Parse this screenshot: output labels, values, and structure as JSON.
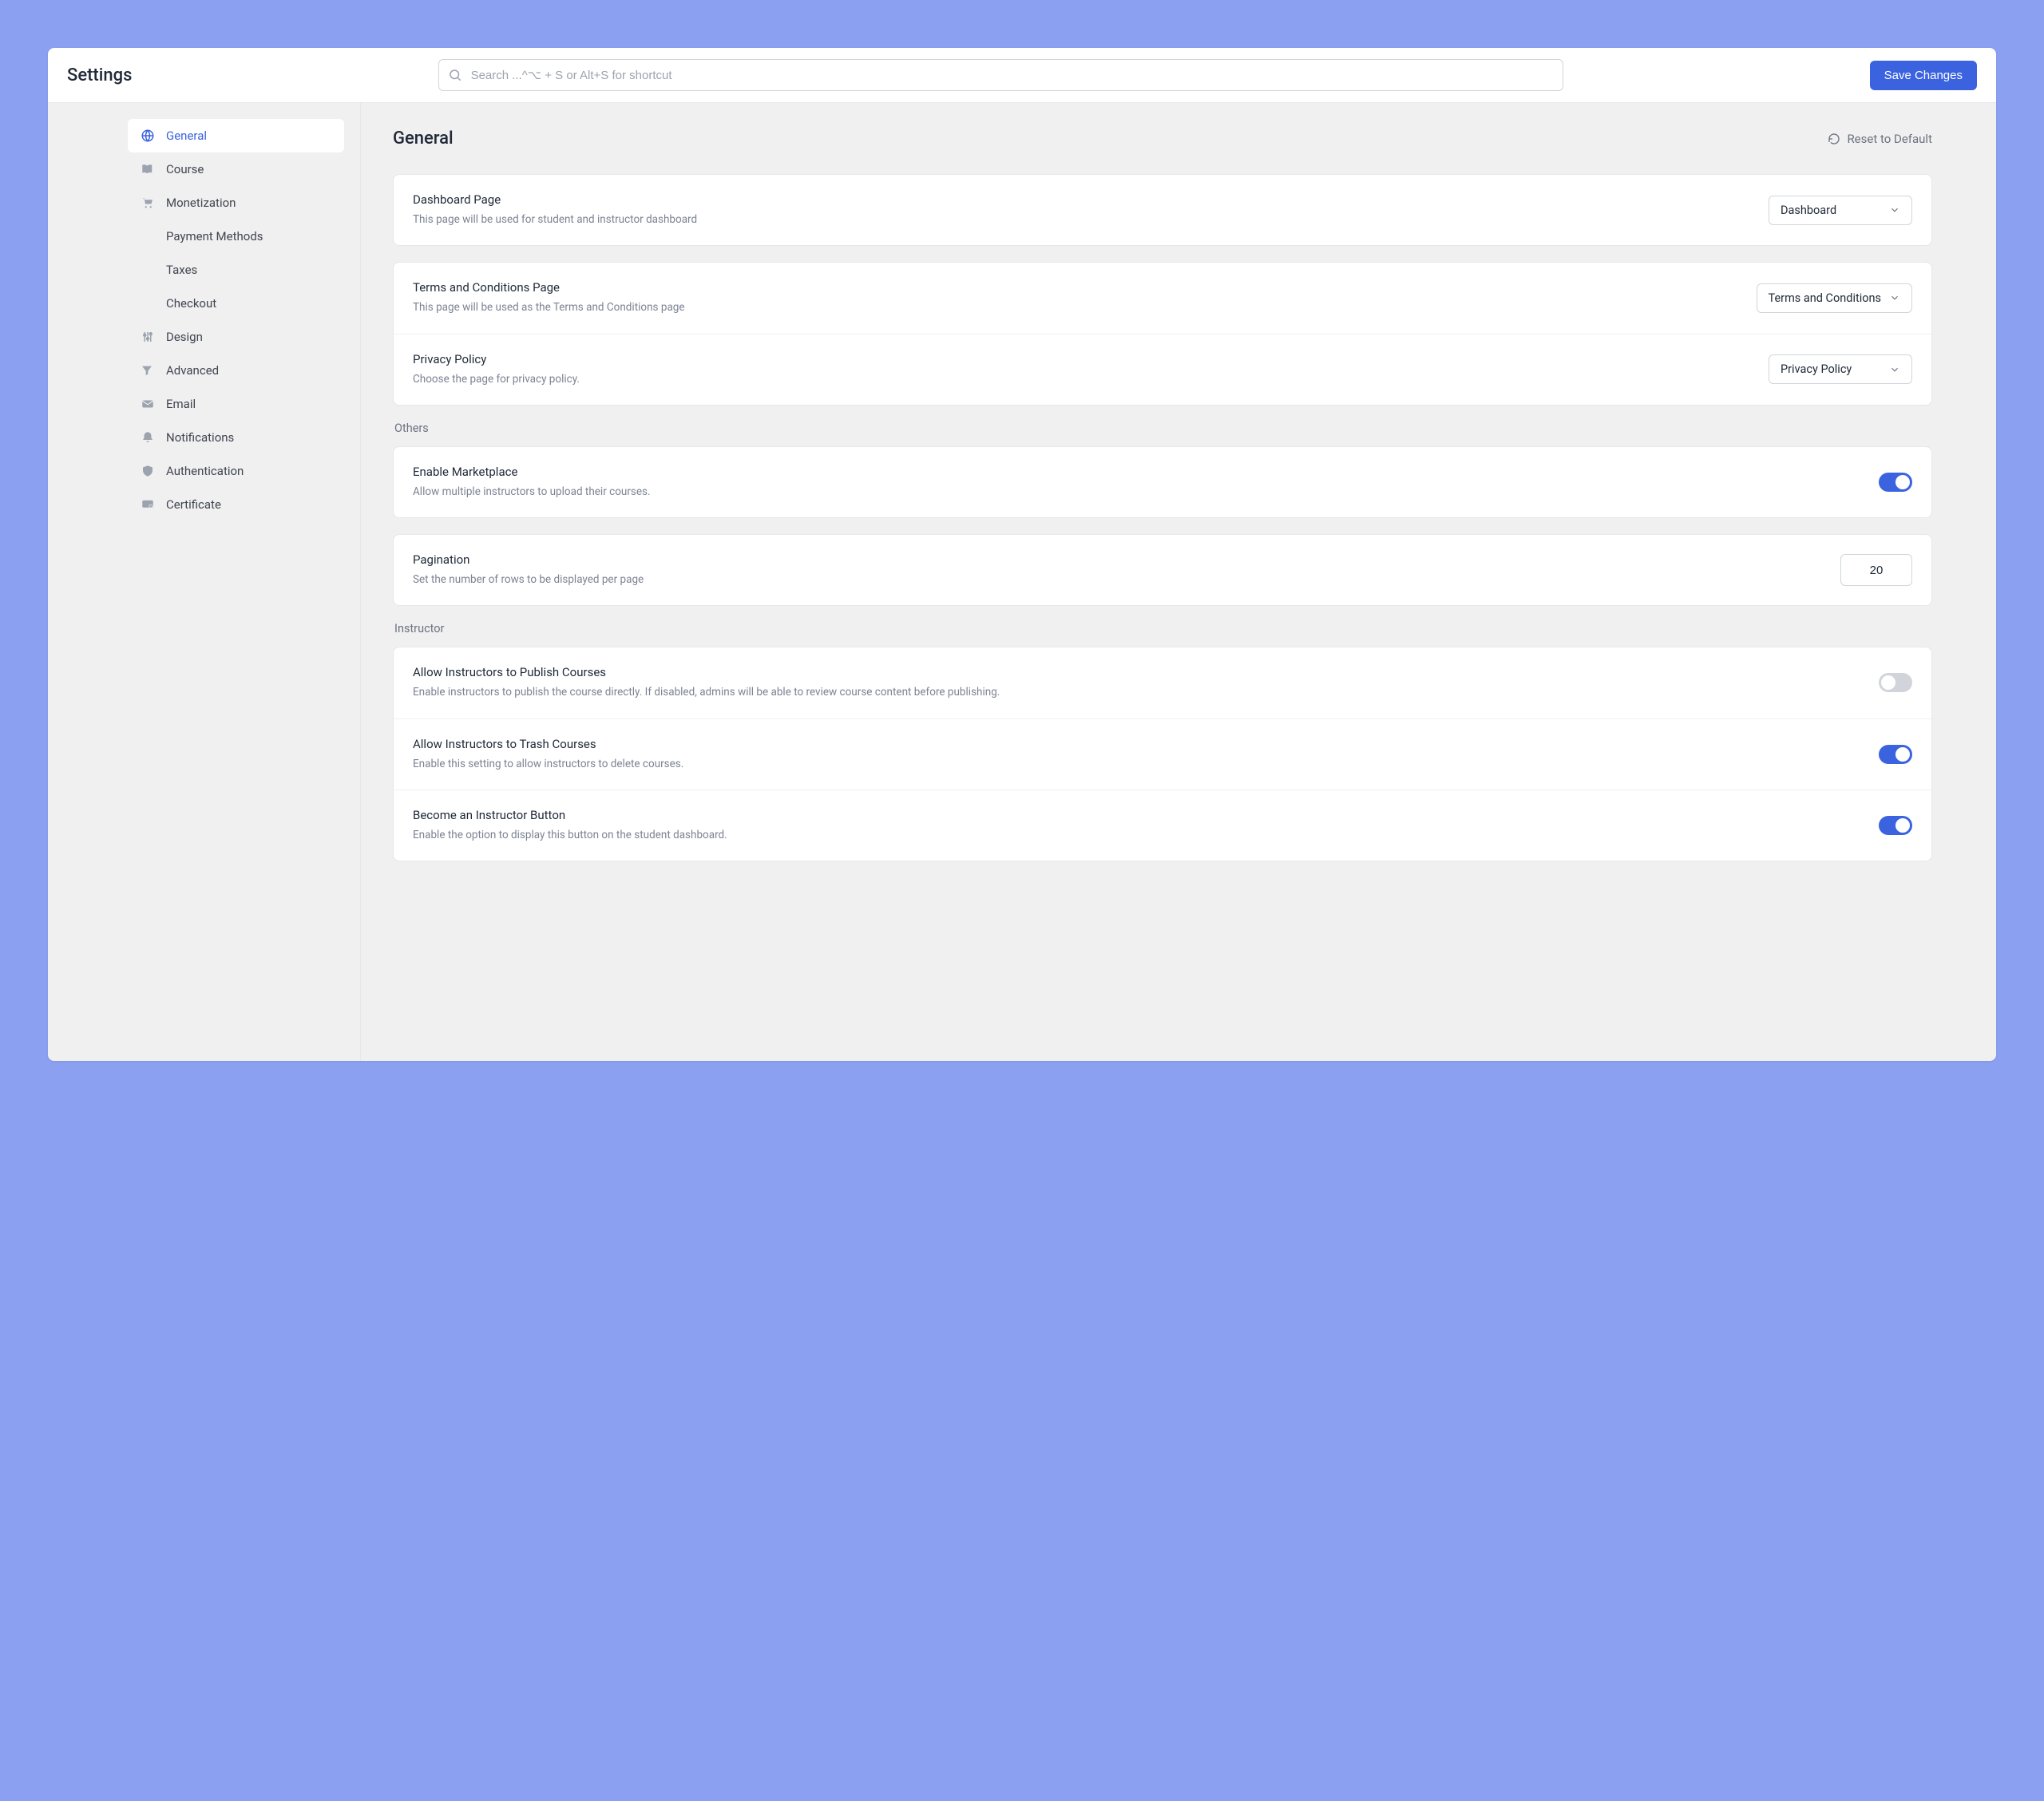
{
  "header": {
    "title": "Settings",
    "search_placeholder": "Search ...^⌥ + S or Alt+S for shortcut",
    "save_label": "Save Changes"
  },
  "sidebar": {
    "items": [
      {
        "id": "general",
        "label": "General",
        "active": true
      },
      {
        "id": "course",
        "label": "Course"
      },
      {
        "id": "monetization",
        "label": "Monetization",
        "children": [
          {
            "id": "payment-methods",
            "label": "Payment Methods"
          },
          {
            "id": "taxes",
            "label": "Taxes"
          },
          {
            "id": "checkout",
            "label": "Checkout"
          }
        ]
      },
      {
        "id": "design",
        "label": "Design"
      },
      {
        "id": "advanced",
        "label": "Advanced"
      },
      {
        "id": "email",
        "label": "Email"
      },
      {
        "id": "notifications",
        "label": "Notifications"
      },
      {
        "id": "authentication",
        "label": "Authentication"
      },
      {
        "id": "certificate",
        "label": "Certificate"
      }
    ]
  },
  "main": {
    "title": "General",
    "reset_label": "Reset to Default",
    "sections": {
      "page": [
        {
          "title": "Dashboard Page",
          "desc": "This page will be used for student and instructor dashboard",
          "select_value": "Dashboard"
        }
      ],
      "terms": [
        {
          "title": "Terms and Conditions Page",
          "desc": "This page will be used as the Terms and Conditions page",
          "select_value": "Terms and Conditions"
        },
        {
          "title": "Privacy Policy",
          "desc": "Choose the page for privacy policy.",
          "select_value": "Privacy Policy"
        }
      ],
      "others_label": "Others",
      "others": [
        {
          "title": "Enable Marketplace",
          "desc": "Allow multiple instructors to upload their courses.",
          "toggle": true
        },
        {
          "title": "Pagination",
          "desc": "Set the number of rows to be displayed per page",
          "value": "20"
        }
      ],
      "instructor_label": "Instructor",
      "instructor": [
        {
          "title": "Allow Instructors to Publish Courses",
          "desc": "Enable instructors to publish the course directly. If disabled, admins will be able to review course content before publishing.",
          "toggle": false
        },
        {
          "title": "Allow Instructors to Trash Courses",
          "desc": "Enable this setting to allow instructors to delete courses.",
          "toggle": true
        },
        {
          "title": "Become an Instructor Button",
          "desc": "Enable the option to display this button on the student dashboard.",
          "toggle": true
        }
      ]
    }
  }
}
